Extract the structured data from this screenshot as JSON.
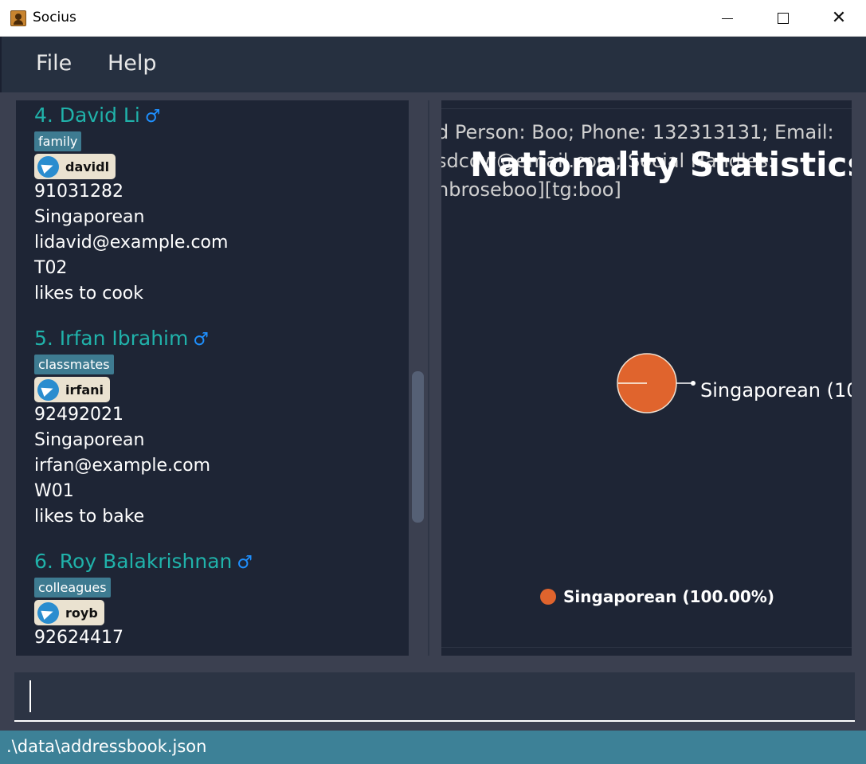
{
  "window": {
    "title": "Socius"
  },
  "menu": {
    "file": "File",
    "help": "Help"
  },
  "persons": [
    {
      "index_name": "4.  David Li",
      "tag": "family",
      "handle": "davidl",
      "phone": "91031282",
      "nationality": "Singaporean",
      "email": "lidavid@example.com",
      "tutorial": "T02",
      "remark": "likes to cook"
    },
    {
      "index_name": "5.  Irfan Ibrahim",
      "tag": "classmates",
      "handle": "irfani",
      "phone": "92492021",
      "nationality": "Singaporean",
      "email": "irfan@example.com",
      "tutorial": "W01",
      "remark": "likes to bake"
    },
    {
      "index_name": "6.  Roy Balakrishnan",
      "tag": "colleagues",
      "handle": "royb",
      "phone": "92624417"
    }
  ],
  "result": {
    "line1": "d Person: Boo; Phone: 132313131; Email:",
    "line2": "sdcow@email.com; Social Handles:",
    "line3": "nbroseboo][tg:boo]"
  },
  "stats": {
    "title": "Nationality Statistics",
    "slice_label": "Singaporean (10",
    "legend_label": "Singaporean (100.00%)"
  },
  "chart_data": {
    "type": "pie",
    "title": "Nationality Statistics",
    "categories": [
      "Singaporean"
    ],
    "values": [
      100.0
    ],
    "colors": [
      "#e0642d"
    ],
    "legend": "bottom"
  },
  "command": {
    "value": ""
  },
  "status": {
    "path": ".\\data\\addressbook.json"
  },
  "colors": {
    "accent_name": "#20b2aa",
    "tag_bg": "#3e7b91",
    "status_bar": "#3d8197",
    "slice": "#e0642d"
  },
  "icons": {
    "gender": "male-gender-icon",
    "social": "telegram-icon"
  }
}
